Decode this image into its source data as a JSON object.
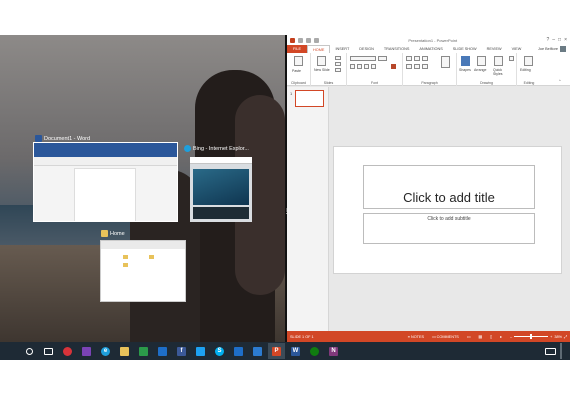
{
  "colors": {
    "ppt_accent": "#d24726",
    "word_accent": "#2b579a",
    "taskbar": "#1e2a35"
  },
  "switcher": {
    "word": {
      "title": "Document1 - Word",
      "icon": "word-icon"
    },
    "ie": {
      "title": "Bing - Internet Explor...",
      "icon": "internet-explorer-icon"
    },
    "explorer": {
      "title": "Home",
      "icon": "folder-icon"
    }
  },
  "powerpoint": {
    "window_title": "Presentation1 - PowerPoint",
    "tabs": [
      "FILE",
      "HOME",
      "INSERT",
      "DESIGN",
      "TRANSITIONS",
      "ANIMATIONS",
      "SLIDE SHOW",
      "REVIEW",
      "VIEW"
    ],
    "user": "Joe Belfiore",
    "ribbon": {
      "groups": [
        "Clipboard",
        "Slides",
        "Font",
        "Paragraph",
        "Drawing",
        "Editing"
      ],
      "paste": "Paste",
      "new_slide": "New Slide",
      "shapes": "Shapes",
      "arrange": "Arrange",
      "quick_styles": "Quick Styles",
      "editing": "Editing"
    },
    "slide_number": "1",
    "title_placeholder": "Click to add title",
    "subtitle_placeholder": "Click to add subtitle",
    "status": {
      "slide": "SLIDE 1 OF 1",
      "notes": "NOTES",
      "comments": "COMMENTS",
      "zoom": "38%"
    }
  },
  "taskbar": {
    "items": [
      {
        "name": "start-icon",
        "color": "#ffffff"
      },
      {
        "name": "search-icon",
        "color": "#ffffff"
      },
      {
        "name": "task-view-icon",
        "color": "#ffffff"
      },
      {
        "name": "music-app-icon",
        "color": "#d8333a"
      },
      {
        "name": "onenote-app-icon",
        "color": "#7a43b6"
      },
      {
        "name": "internet-explorer-icon",
        "color": "#1e9fdc"
      },
      {
        "name": "file-explorer-icon",
        "color": "#e8c25a"
      },
      {
        "name": "store-icon",
        "color": "#2b9a4a"
      },
      {
        "name": "mail-icon",
        "color": "#1e6ec8"
      },
      {
        "name": "facebook-icon",
        "color": "#3b5998"
      },
      {
        "name": "twitter-icon",
        "color": "#1da1f2"
      },
      {
        "name": "skype-icon",
        "color": "#00aff0"
      },
      {
        "name": "calendar-icon",
        "color": "#1e6ec8"
      },
      {
        "name": "photos-icon",
        "color": "#2c7bd0"
      },
      {
        "name": "powerpoint-icon",
        "color": "#d24726"
      },
      {
        "name": "word-icon",
        "color": "#2b579a"
      },
      {
        "name": "xbox-icon",
        "color": "#107c10"
      },
      {
        "name": "onenote-icon",
        "color": "#80397b"
      }
    ]
  }
}
